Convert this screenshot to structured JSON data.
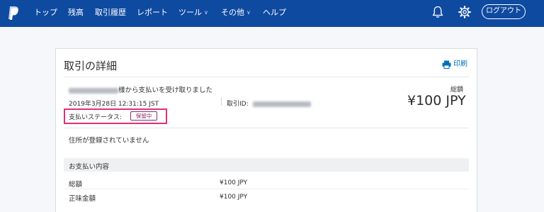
{
  "nav": {
    "items": [
      {
        "label": "トップ",
        "dropdown": false
      },
      {
        "label": "残高",
        "dropdown": false
      },
      {
        "label": "取引履歴",
        "dropdown": false
      },
      {
        "label": "レポート",
        "dropdown": false
      },
      {
        "label": "ツール",
        "dropdown": true
      },
      {
        "label": "その他",
        "dropdown": true
      },
      {
        "label": "ヘルプ",
        "dropdown": false
      }
    ],
    "logout_label": "ログアウト",
    "icons": [
      "paypal-logo-icon",
      "bell-icon",
      "gear-icon",
      "chevron-down-icon"
    ]
  },
  "transaction": {
    "title": "取引の詳細",
    "print_label": "印刷",
    "received_text": "様から支払いを受け取りました",
    "total_label": "総額",
    "date": "2019年3月28日 12:31:15 JST",
    "txid_label": "取引ID:",
    "amount": "¥100 JPY",
    "status_label": "支払いステータス:",
    "status_badge": "保留中",
    "address_text": "住所が登録されていません"
  },
  "payment_details": {
    "heading": "お支払い内容",
    "rows": [
      {
        "label": "総額",
        "value": "¥100 JPY"
      },
      {
        "label": "正味金額",
        "value": "¥100 JPY"
      }
    ]
  },
  "colors": {
    "header_bg": "#0f4aa1",
    "link": "#0070ba",
    "highlight_border": "#e0307a",
    "badge": "#8a2d6a"
  }
}
